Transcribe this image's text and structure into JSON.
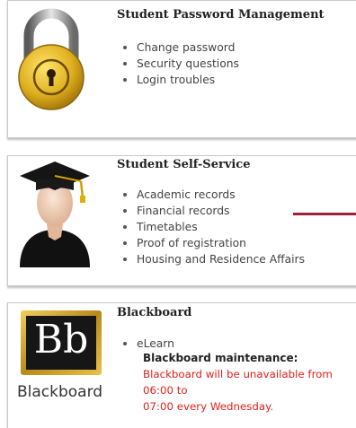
{
  "cards": [
    {
      "title": "Student Password Management",
      "items": [
        "Change password",
        "Security questions",
        "Login troubles"
      ],
      "icon": "padlock-icon"
    },
    {
      "title": "Student Self-Service",
      "items": [
        "Academic records",
        "Financial records",
        "Timetables",
        "Proof of registration",
        "Housing and Residence Affairs"
      ],
      "icon": "graduate-avatar-icon"
    },
    {
      "title": "Blackboard",
      "items": [
        "eLearn"
      ],
      "icon": "blackboard-logo-icon",
      "logo_text": "Bb",
      "logo_caption": "Blackboard",
      "maintenance_title": "Blackboard maintenance:",
      "maintenance_line1": "Blackboard will be unavailable from",
      "maintenance_line2": "06:00 to",
      "maintenance_line3": "07:00 every Wednesday."
    }
  ],
  "colors": {
    "maintenance_red": "#e0201c",
    "accent_line": "#a0203a",
    "padlock_gold": "#d4a017"
  }
}
